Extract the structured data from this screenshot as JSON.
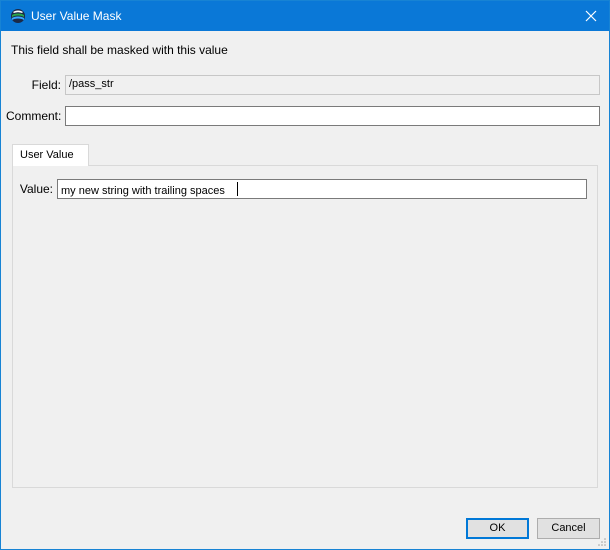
{
  "window": {
    "title": "User Value Mask",
    "app_icon": "app-icon"
  },
  "dialog": {
    "description": "This field shall be masked with this value",
    "field_label": "Field:",
    "field_value": "/pass_str",
    "comment_label": "Comment:",
    "comment_value": ""
  },
  "tabs": [
    {
      "label": "User Value",
      "selected": true
    }
  ],
  "user_value": {
    "label": "Value:",
    "value": "my new string with trailing spaces"
  },
  "buttons": {
    "ok": "OK",
    "cancel": "Cancel"
  },
  "colors": {
    "titlebar": "#0a78d7",
    "accent": "#0078d7",
    "background": "#f0f0f0"
  }
}
